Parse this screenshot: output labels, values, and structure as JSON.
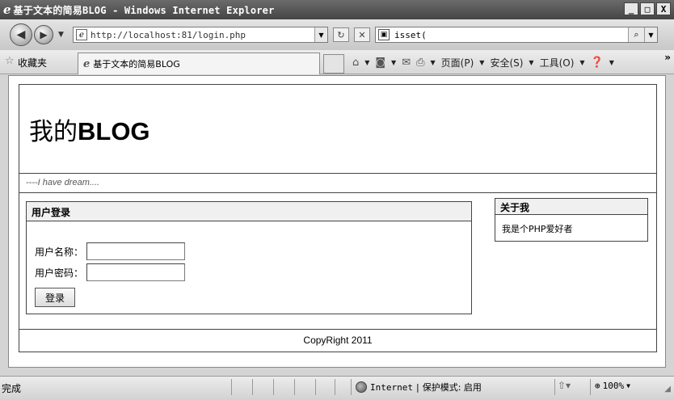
{
  "window": {
    "title": "基于文本的简易BLOG - Windows Internet Explorer",
    "minimize": "_",
    "maximize": "□",
    "close": "X"
  },
  "address": {
    "url": "http://localhost:81/login.php",
    "search_text": "isset("
  },
  "favorites": {
    "label": "收藏夹",
    "tab_label": "基于文本的简易BLOG"
  },
  "commandbar": {
    "page_label": "页面(P)",
    "safety_label": "安全(S)",
    "tools_label": "工具(O)"
  },
  "page": {
    "title_prefix": "我的",
    "title_bold": "BLOG",
    "tagline": "----I have dream....",
    "login": {
      "heading": "用户登录",
      "username_label": "用户名称：",
      "password_label": "用户密码：",
      "username_value": "",
      "password_value": "",
      "submit_label": "登录"
    },
    "about": {
      "heading": "关于我",
      "text": "我是个PHP爱好者"
    },
    "footer": "CopyRight 2011"
  },
  "status": {
    "text": "完成",
    "zone": "Internet",
    "separator": "|",
    "protected_mode": "保护模式: 启用",
    "zoom": "100%"
  }
}
